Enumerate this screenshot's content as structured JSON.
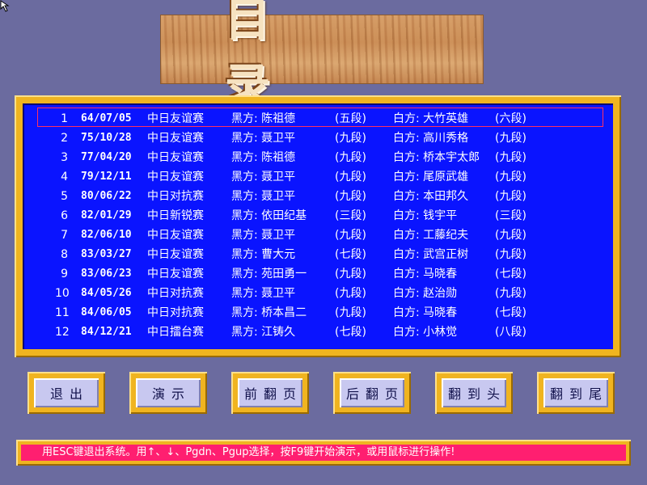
{
  "title": "目 录",
  "games": [
    {
      "no": "1",
      "date": "64/07/05",
      "event": "中日友谊赛",
      "black": "黑方: 陈祖德",
      "black_rank": "(五段)",
      "white": "白方: 大竹英雄",
      "white_rank": "(六段)",
      "selected": true
    },
    {
      "no": "2",
      "date": "75/10/28",
      "event": "中日友谊赛",
      "black": "黑方: 聂卫平",
      "black_rank": "(九段)",
      "white": "白方: 高川秀格",
      "white_rank": "(九段)"
    },
    {
      "no": "3",
      "date": "77/04/20",
      "event": "中日友谊赛",
      "black": "黑方: 陈祖德",
      "black_rank": "(九段)",
      "white": "白方: 桥本宇太郎",
      "white_rank": "(九段)"
    },
    {
      "no": "4",
      "date": "79/12/11",
      "event": "中日友谊赛",
      "black": "黑方: 聂卫平",
      "black_rank": "(九段)",
      "white": "白方: 尾原武雄",
      "white_rank": "(九段)"
    },
    {
      "no": "5",
      "date": "80/06/22",
      "event": "中日对抗赛",
      "black": "黑方: 聂卫平",
      "black_rank": "(九段)",
      "white": "白方: 本田邦久",
      "white_rank": "(九段)"
    },
    {
      "no": "6",
      "date": "82/01/29",
      "event": "中日新锐赛",
      "black": "黑方: 依田纪基",
      "black_rank": "(三段)",
      "white": "白方: 钱宇平",
      "white_rank": "(三段)"
    },
    {
      "no": "7",
      "date": "82/06/10",
      "event": "中日友谊赛",
      "black": "黑方: 聂卫平",
      "black_rank": "(九段)",
      "white": "白方: 工藤纪夫",
      "white_rank": "(九段)"
    },
    {
      "no": "8",
      "date": "83/03/27",
      "event": "中日友谊赛",
      "black": "黑方: 曹大元",
      "black_rank": "(七段)",
      "white": "白方: 武宫正树",
      "white_rank": "(九段)"
    },
    {
      "no": "9",
      "date": "83/06/23",
      "event": "中日友谊赛",
      "black": "黑方: 苑田勇一",
      "black_rank": "(九段)",
      "white": "白方: 马晓春",
      "white_rank": "(七段)"
    },
    {
      "no": "10",
      "date": "84/05/26",
      "event": "中日对抗赛",
      "black": "黑方: 聂卫平",
      "black_rank": "(九段)",
      "white": "白方: 赵治勋",
      "white_rank": "(九段)"
    },
    {
      "no": "11",
      "date": "84/06/05",
      "event": "中日对抗赛",
      "black": "黑方: 桥本昌二",
      "black_rank": "(九段)",
      "white": "白方: 马晓春",
      "white_rank": "(七段)"
    },
    {
      "no": "12",
      "date": "84/12/21",
      "event": "中日擂台赛",
      "black": "黑方: 江铸久",
      "black_rank": "(七段)",
      "white": "白方: 小林觉",
      "white_rank": "(八段)"
    }
  ],
  "buttons": {
    "exit": "退出",
    "play": "演示",
    "prev_page": "前翻页",
    "next_page": "后翻页",
    "first": "翻到头",
    "last": "翻到尾"
  },
  "status": "用ESC键退出系统。用↑、↓、Pgdn、Pgup选择，按F9键开始演示，或用鼠标进行操作!",
  "colors": {
    "background": "#6b6b9f",
    "frame": "#f0b420",
    "list_bg": "#0a14ff",
    "selection": "#ff3060",
    "status_bg": "#ff1f70",
    "button_face": "#c8c8f0"
  }
}
